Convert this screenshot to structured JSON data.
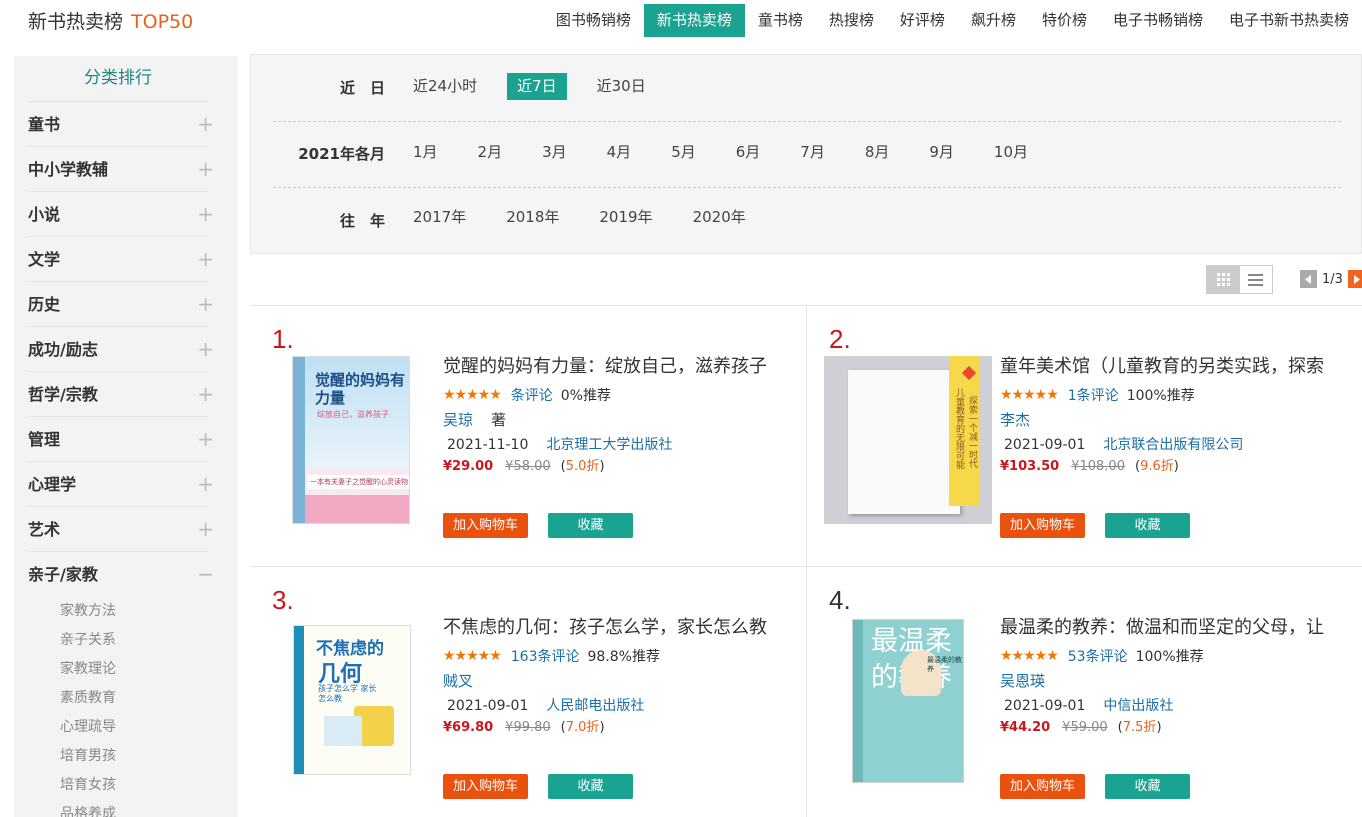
{
  "header": {
    "brand": "新书热卖榜",
    "brand_top": "TOP50",
    "nav": [
      "图书畅销榜",
      "新书热卖榜",
      "童书榜",
      "热搜榜",
      "好评榜",
      "飙升榜",
      "特价榜",
      "电子书畅销榜",
      "电子书新书热卖榜"
    ],
    "active_nav": "新书热卖榜"
  },
  "sidebar": {
    "title": "分类排行",
    "categories": [
      "童书",
      "中小学教辅",
      "小说",
      "文学",
      "历史",
      "成功/励志",
      "哲学/宗教",
      "管理",
      "心理学",
      "艺术"
    ],
    "expanded": {
      "label": "亲子/家教",
      "subitems": [
        "家教方法",
        "亲子关系",
        "家教理论",
        "素质教育",
        "心理疏导",
        "培育男孩",
        "培育女孩",
        "品格养成"
      ]
    },
    "plus_symbol": "+",
    "minus_symbol": "−"
  },
  "filter": {
    "recent_label": "近　日",
    "recent": [
      "近24小时",
      "近7日",
      "近30日"
    ],
    "recent_active": "近7日",
    "month_label": "2021年各月",
    "months": [
      "1月",
      "2月",
      "3月",
      "4月",
      "5月",
      "6月",
      "7月",
      "8月",
      "9月",
      "10月"
    ],
    "year_label": "往　年",
    "years": [
      "2017年",
      "2018年",
      "2019年",
      "2020年"
    ]
  },
  "pager": {
    "current": "1",
    "total": "3",
    "text": "1/3"
  },
  "books": [
    {
      "rank": "1.",
      "title": "觉醒的妈妈有力量：绽放自己，滋养孩子",
      "stars": "★★★★★",
      "reviews": "条评论",
      "recommend": "0%推荐",
      "author": "吴琼",
      "role": "著",
      "date": "2021-11-10",
      "press": "北京理工大学出版社",
      "price": "¥29.00",
      "old_price": "¥58.00",
      "discount_pre": "(",
      "discount": "5.0折",
      "discount_post": ")",
      "cart": "加入购物车",
      "fav": "收藏",
      "cover_title": "觉醒的妈妈有力量",
      "cover_sub": "绽放自己，滋养孩子",
      "cover_band": "一本有关妻子之觉醒的心灵读物"
    },
    {
      "rank": "2.",
      "title": "童年美术馆（儿童教育的另类实践，探索",
      "stars": "★★★★★",
      "reviews": "1条评论",
      "recommend": "100%推荐",
      "author": "李杰",
      "role": "",
      "date": "2021-09-01",
      "press": "北京联合出版有限公司",
      "price": "¥103.50",
      "old_price": "¥108.00",
      "discount_pre": "(",
      "discount": "9.6折",
      "discount_post": ")",
      "cart": "加入购物车",
      "fav": "收藏",
      "cover_band": "儿童教育的无限可能",
      "cover_band2": "探索一个减一时代"
    },
    {
      "rank": "3.",
      "title": "不焦虑的几何：孩子怎么学，家长怎么教",
      "stars": "★★★★★",
      "reviews": "163条评论",
      "recommend": "98.8%推荐",
      "author": "贼叉",
      "role": "",
      "date": "2021-09-01",
      "press": "人民邮电出版社",
      "price": "¥69.80",
      "old_price": "¥99.80",
      "discount_pre": "(",
      "discount": "7.0折",
      "discount_post": ")",
      "cart": "加入购物车",
      "fav": "收藏",
      "cover_title1": "不焦虑的",
      "cover_title2": "几何",
      "cover_sub": "孩子怎么学 家长怎么教"
    },
    {
      "rank": "4.",
      "title": "最温柔的教养：做温和而坚定的父母，让",
      "stars": "★★★★★",
      "reviews": "53条评论",
      "recommend": "100%推荐",
      "author": "吴恩瑛",
      "role": "",
      "date": "2021-09-01",
      "press": "中信出版社",
      "price": "¥44.20",
      "old_price": "¥59.00",
      "discount_pre": "(",
      "discount": "7.5折",
      "discount_post": ")",
      "cart": "加入购物车",
      "fav": "收藏",
      "cover_title1": "最温柔",
      "cover_title2": "的教养",
      "cover_small": "最温柔的教养"
    }
  ],
  "colors": {
    "accent": "#1aa391",
    "brand_orange": "#e8621b",
    "cart": "#e8510e",
    "price_red": "#c9171e",
    "link_blue": "#1a6fa8",
    "star": "#f07800"
  }
}
